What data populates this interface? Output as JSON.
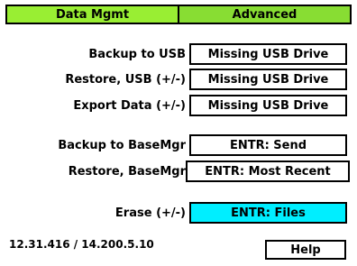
{
  "tabs": [
    {
      "label": "Data Mgmt",
      "active": true
    },
    {
      "label": "Advanced",
      "active": false
    }
  ],
  "rows": [
    {
      "label": "Backup to USB",
      "value": "Missing USB Drive"
    },
    {
      "label": "Restore, USB (+/-)",
      "value": "Missing USB Drive"
    },
    {
      "label": "Export Data (+/-)",
      "value": "Missing USB Drive"
    },
    {
      "label": "Backup to BaseMgr",
      "value": "ENTR:  Send"
    },
    {
      "label": "Restore, BaseMgr",
      "value": "ENTR:  Most Recent"
    },
    {
      "label": "Erase (+/-)",
      "value": "ENTR:  Files",
      "selected": true
    }
  ],
  "footer": {
    "version": "12.31.416 / 14.200.5.10",
    "help_label": "Help"
  },
  "colors": {
    "tab_active": "#99ee33",
    "tab_inactive": "#88dd33",
    "selected": "#00eeff"
  }
}
